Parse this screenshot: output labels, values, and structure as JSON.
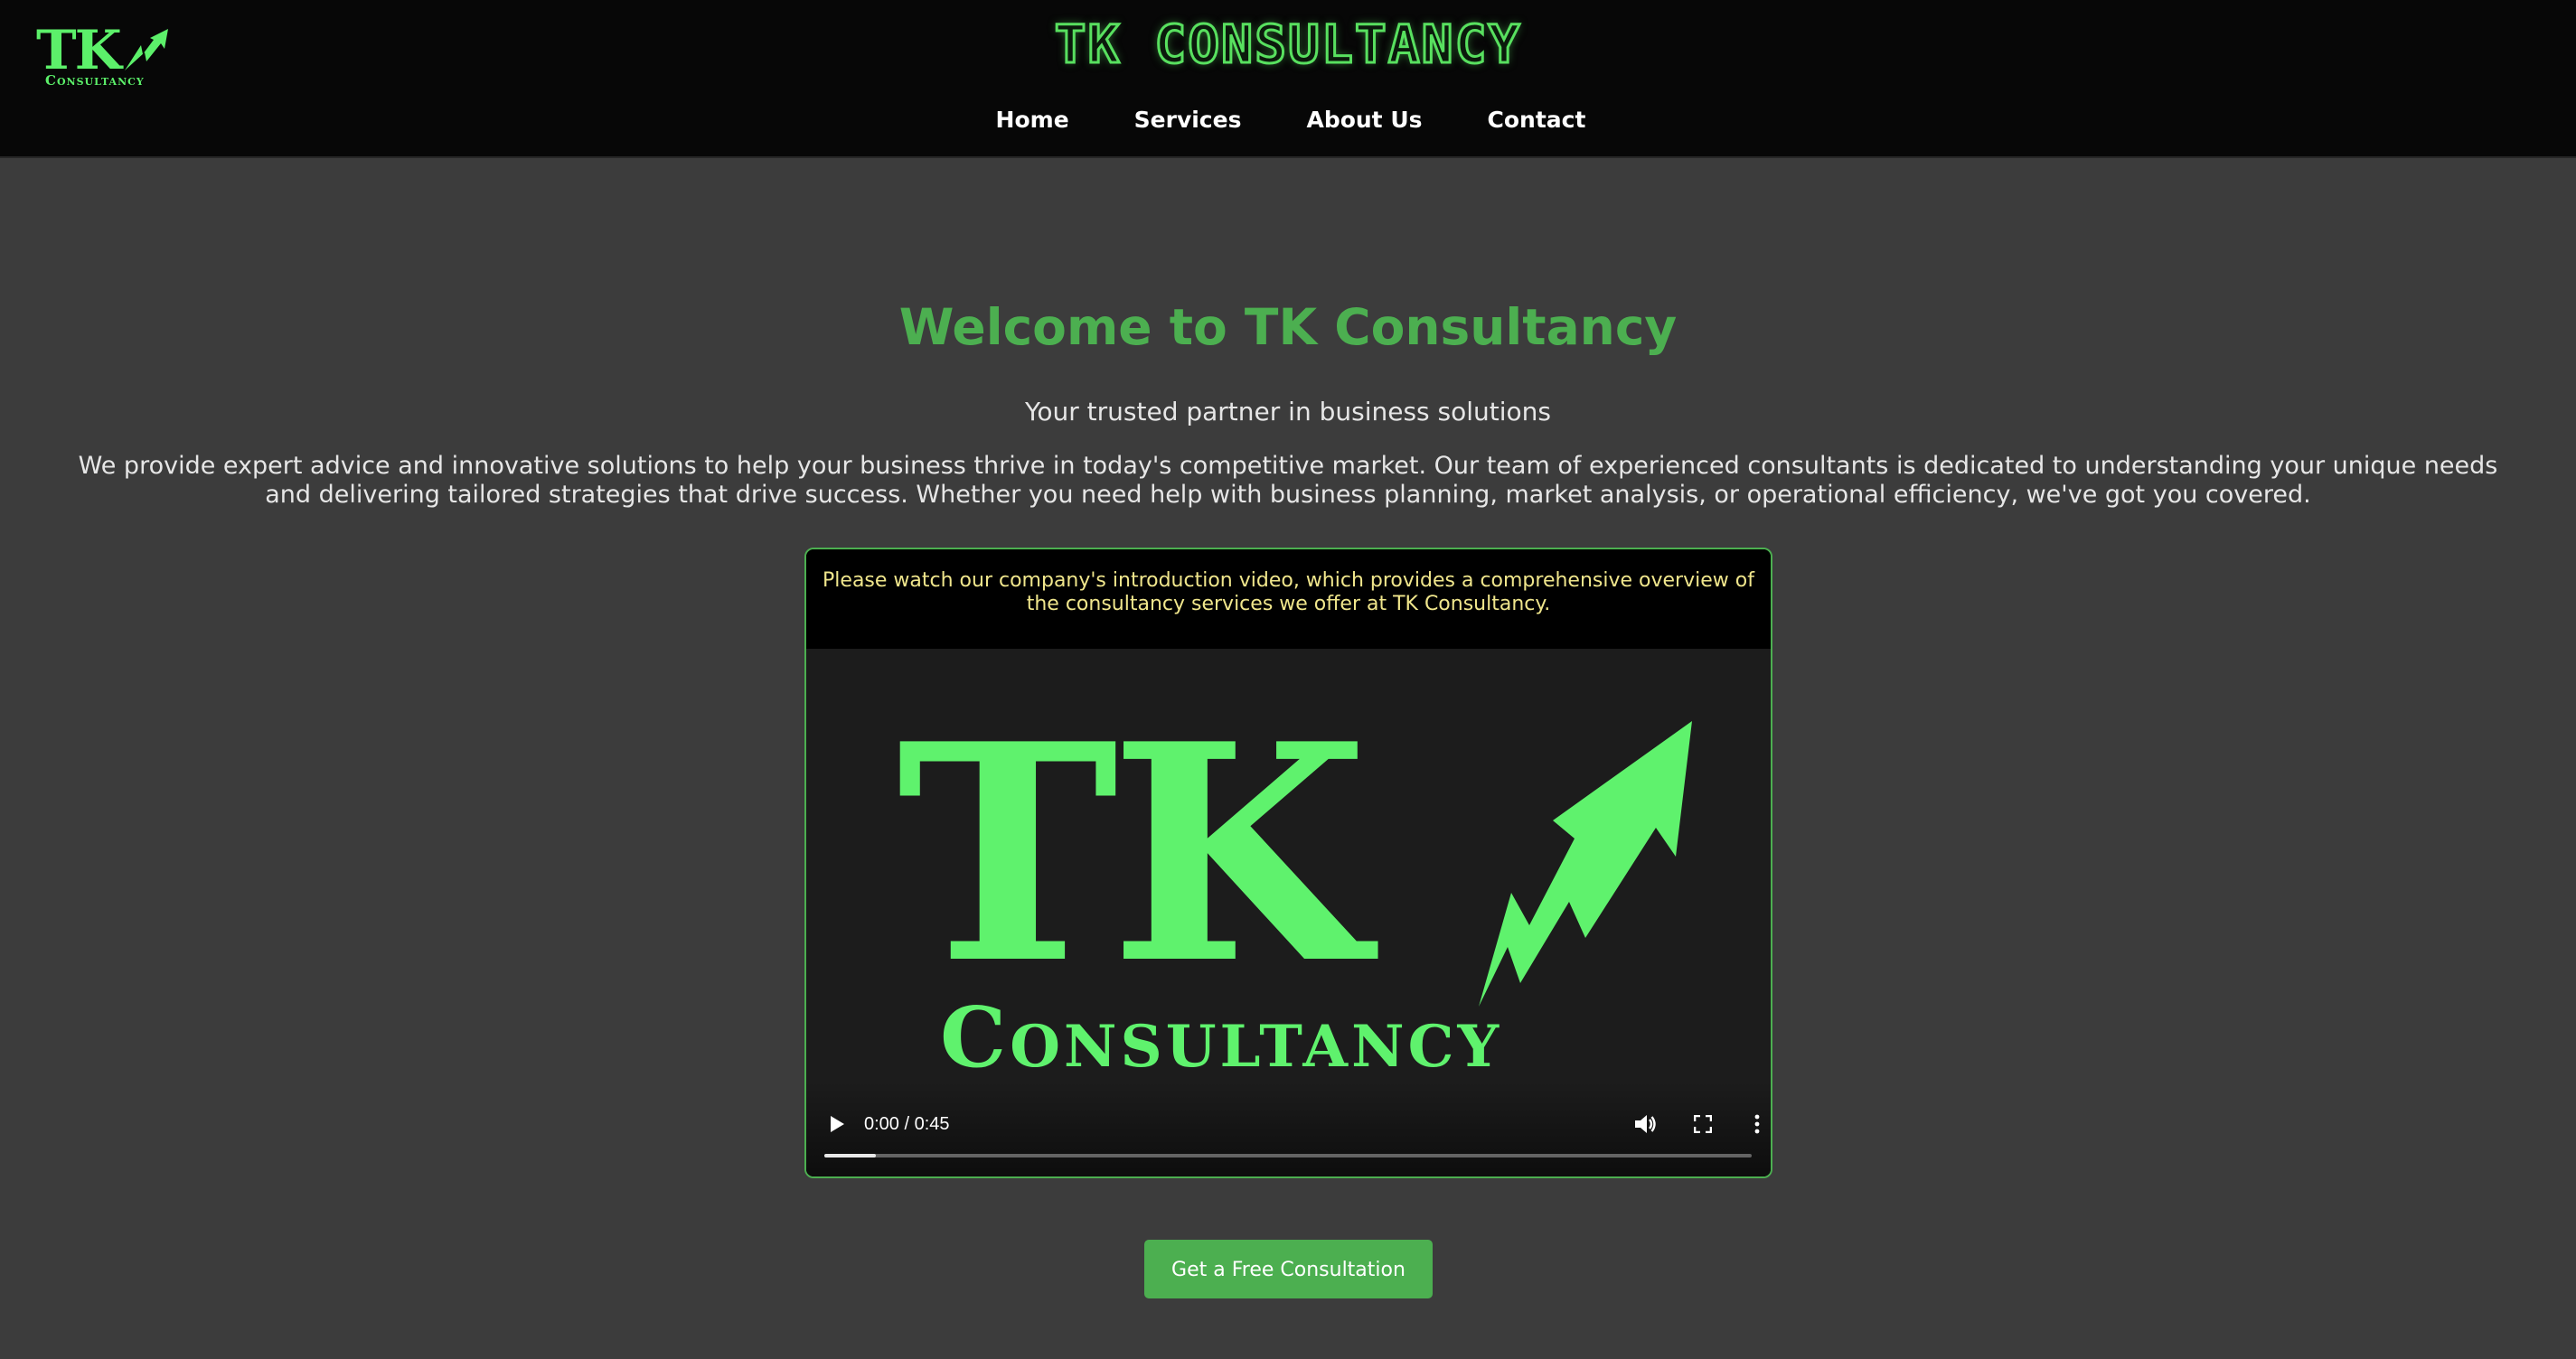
{
  "header": {
    "logo": {
      "mark": "TK",
      "subtitle": "Consultancy",
      "icon": "growth-arrow-icon"
    },
    "brand_title": "TK CONSULTANCY",
    "nav": [
      {
        "label": "Home"
      },
      {
        "label": "Services"
      },
      {
        "label": "About Us"
      },
      {
        "label": "Contact"
      }
    ]
  },
  "hero": {
    "title": "Welcome to TK Consultancy",
    "tagline": "Your trusted partner in business solutions",
    "description": "We provide expert advice and innovative solutions to help your business thrive in today's competitive market. Our team of experienced consultants is dedicated to understanding your unique needs and delivering tailored strategies that drive success. Whether you need help with business planning, market analysis, or operational efficiency, we've got you covered."
  },
  "video": {
    "caption": "Please watch our company's introduction video, which provides a comprehensive overview of the consultancy services we offer at TK Consultancy.",
    "poster": {
      "mark": "TK",
      "subtitle": "Consultancy",
      "icon": "growth-arrow-icon"
    },
    "time_display": "0:00 / 0:45",
    "buffered_fraction": 0.056,
    "controls": [
      "play-icon",
      "volume-icon",
      "fullscreen-icon",
      "more-options-icon"
    ]
  },
  "cta": {
    "label": "Get a Free Consultation"
  },
  "colors": {
    "accent_green": "#4caf50",
    "logo_green": "#5ff26d",
    "header_bg": "#070707",
    "page_bg": "#3c3c3c",
    "caption_text": "#f0e68c"
  }
}
